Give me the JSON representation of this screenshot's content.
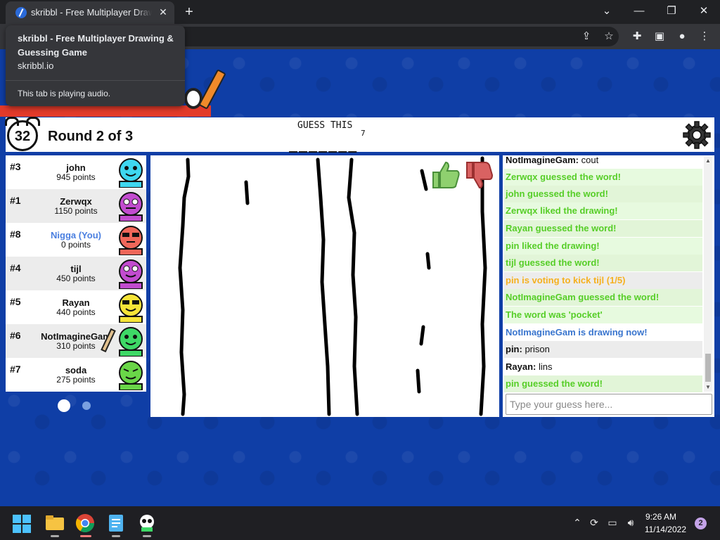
{
  "browser": {
    "tab_title": "skribbl - Free Multiplayer Drawing & Guessing Game",
    "tooltip": {
      "title": "skribbl - Free Multiplayer Drawing & Guessing Game",
      "url": "skribbl.io",
      "audio": "This tab is playing audio."
    },
    "close_glyph": "✕",
    "newtab_glyph": "+"
  },
  "game": {
    "timer": "32",
    "round": "Round 2 of 3",
    "guess_label": "GUESS THIS",
    "word_length": "7",
    "word_blanks": "_______"
  },
  "players": [
    {
      "rank": "#3",
      "name": "john",
      "points": "945 points",
      "color": "#3ed7f0"
    },
    {
      "rank": "#1",
      "name": "Zerwqx",
      "points": "1150 points",
      "color": "#c24ccf"
    },
    {
      "rank": "#8",
      "name": "Nigga (You)",
      "points": "0 points",
      "color": "#f0675a"
    },
    {
      "rank": "#4",
      "name": "tijl",
      "points": "450 points",
      "color": "#c24ccf"
    },
    {
      "rank": "#5",
      "name": "Rayan",
      "points": "440 points",
      "color": "#f6e438"
    },
    {
      "rank": "#6",
      "name": "NotImagineGam",
      "points": "310 points",
      "color": "#3ed866"
    },
    {
      "rank": "#7",
      "name": "soda",
      "points": "275 points",
      "color": "#6ad648"
    }
  ],
  "chat": {
    "messages": [
      {
        "author": "NotImagineGam:",
        "text": " cout"
      },
      {
        "text": "Zerwqx guessed the word!"
      },
      {
        "text": "john guessed the word!"
      },
      {
        "text": "Zerwqx liked the drawing!"
      },
      {
        "text": "Rayan guessed the word!"
      },
      {
        "text": "pin liked the drawing!"
      },
      {
        "text": "tijl guessed the word!"
      },
      {
        "text": "pin is voting to kick tijl (1/5)"
      },
      {
        "text": "NotImagineGam guessed the word!"
      },
      {
        "text": "The word was 'pocket'"
      },
      {
        "text": "NotImagineGam is drawing now!"
      },
      {
        "author": "pin:",
        "text": " prison"
      },
      {
        "author": "Rayan:",
        "text": " lins"
      },
      {
        "text": "pin guessed the word!"
      }
    ],
    "input_placeholder": "Type your guess here..."
  },
  "taskbar": {
    "time": "9:26 AM",
    "date": "11/14/2022",
    "notifications": "2"
  }
}
